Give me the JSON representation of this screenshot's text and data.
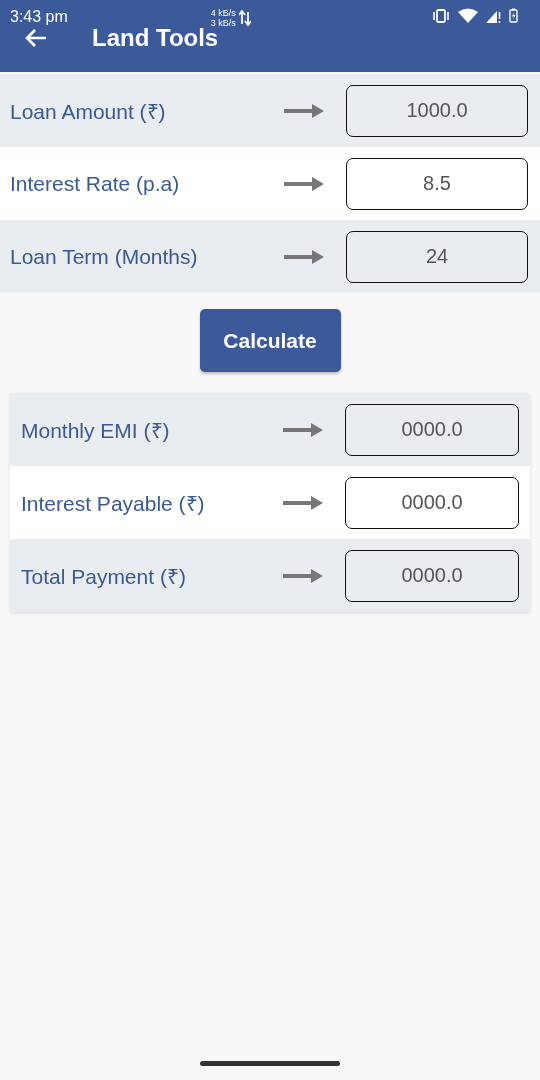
{
  "status_bar": {
    "time": "3:43 pm",
    "upload_speed": "4 kB/s",
    "download_speed": "3 kB/s"
  },
  "app_bar": {
    "title": "Land Tools"
  },
  "inputs": [
    {
      "label": "Loan Amount (₹)",
      "value": "1000.0"
    },
    {
      "label": "Interest Rate (p.a)",
      "value": "8.5"
    },
    {
      "label": "Loan Term (Months)",
      "value": "24"
    }
  ],
  "calculate_button": "Calculate",
  "results": [
    {
      "label": "Monthly EMI (₹)",
      "value": "0000.0"
    },
    {
      "label": "Interest Payable (₹)",
      "value": "0000.0"
    },
    {
      "label": "Total Payment (₹)",
      "value": "0000.0"
    }
  ]
}
